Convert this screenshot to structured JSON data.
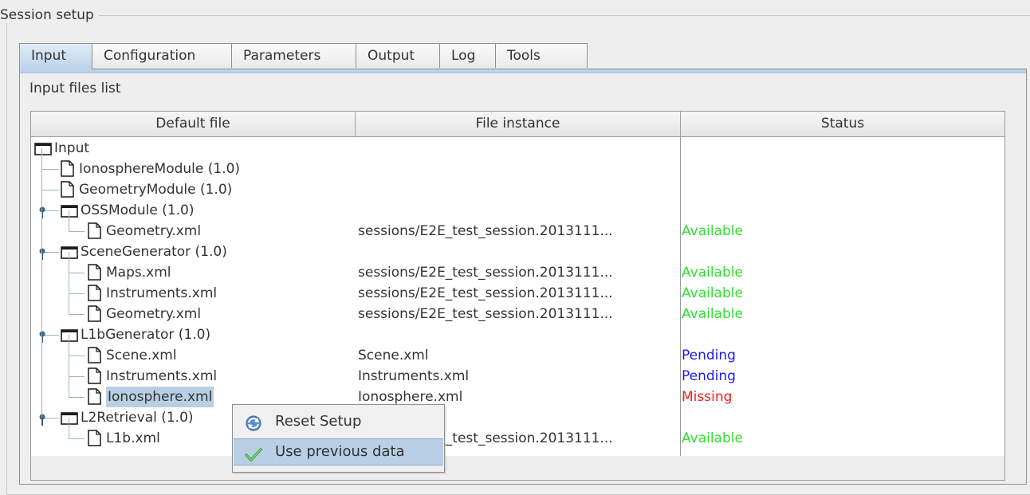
{
  "group": {
    "legend": "Session setup"
  },
  "tabs": [
    {
      "label": "Input",
      "active": true
    },
    {
      "label": "Configuration",
      "active": false
    },
    {
      "label": "Parameters",
      "active": false
    },
    {
      "label": "Output",
      "active": false
    },
    {
      "label": "Log",
      "active": false
    },
    {
      "label": "Tools",
      "active": false
    }
  ],
  "files": {
    "title": "Input files list",
    "columns": [
      "Default file",
      "File instance",
      "Status"
    ],
    "rows": [
      {
        "name": "Input",
        "icon": "folder-icon",
        "instance": "",
        "status": "",
        "status_type": ""
      },
      {
        "name": "IonosphereModule (1.0)",
        "icon": "file-icon",
        "instance": "",
        "status": "",
        "status_type": ""
      },
      {
        "name": "GeometryModule (1.0)",
        "icon": "file-icon",
        "instance": "",
        "status": "",
        "status_type": ""
      },
      {
        "name": "OSSModule (1.0)",
        "icon": "folder-icon",
        "instance": "",
        "status": "",
        "status_type": ""
      },
      {
        "name": "Geometry.xml",
        "icon": "file-icon",
        "instance": "sessions/E2E_test_session.2013111...",
        "status": "Available",
        "status_type": "available"
      },
      {
        "name": "SceneGenerator (1.0)",
        "icon": "folder-icon",
        "instance": "",
        "status": "",
        "status_type": ""
      },
      {
        "name": "Maps.xml",
        "icon": "file-icon",
        "instance": "sessions/E2E_test_session.2013111...",
        "status": "Available",
        "status_type": "available"
      },
      {
        "name": "Instruments.xml",
        "icon": "file-icon",
        "instance": "sessions/E2E_test_session.2013111...",
        "status": "Available",
        "status_type": "available"
      },
      {
        "name": "Geometry.xml",
        "icon": "file-icon",
        "instance": "sessions/E2E_test_session.2013111...",
        "status": "Available",
        "status_type": "available"
      },
      {
        "name": "L1bGenerator (1.0)",
        "icon": "folder-icon",
        "instance": "",
        "status": "",
        "status_type": ""
      },
      {
        "name": "Scene.xml",
        "icon": "file-icon",
        "instance": "Scene.xml",
        "status": "Pending",
        "status_type": "pending"
      },
      {
        "name": "Instruments.xml",
        "icon": "file-icon",
        "instance": "Instruments.xml",
        "status": "Pending",
        "status_type": "pending"
      },
      {
        "name": "Ionosphere.xml",
        "icon": "file-icon",
        "instance": "Ionosphere.xml",
        "status": "Missing",
        "status_type": "missing",
        "selected": true
      },
      {
        "name": "L2Retrieval (1.0)",
        "icon": "folder-icon",
        "instance": "",
        "status": "",
        "status_type": ""
      },
      {
        "name": "L1b.xml",
        "icon": "file-icon",
        "instance": "sessions/E2E_test_session.2013111...",
        "status": "Available",
        "status_type": "available"
      }
    ]
  },
  "context_menu": {
    "items": [
      {
        "label": "Reset Setup",
        "icon": "refresh-icon",
        "highlighted": false
      },
      {
        "label": "Use previous data",
        "icon": "checkmark-icon",
        "highlighted": true
      }
    ]
  },
  "colors": {
    "available": "#2ee02e",
    "pending": "#1a1af0",
    "missing": "#f02020",
    "selection": "#b8cfe5"
  }
}
